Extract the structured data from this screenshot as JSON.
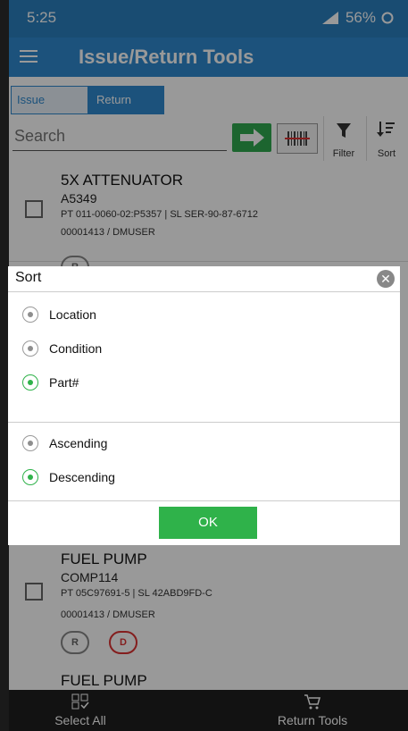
{
  "status": {
    "time": "5:25",
    "battery": "56%"
  },
  "app": {
    "title": "Issue/Return Tools"
  },
  "tabs": [
    {
      "label": "Issue"
    },
    {
      "label": "Return"
    }
  ],
  "search": {
    "placeholder": "Search",
    "filter_label": "Filter",
    "sort_label": "Sort"
  },
  "items": [
    {
      "title": "5X ATTENUATOR",
      "code": "A5349",
      "pt": "PT 011-0060-02:P5357 | SL SER-90-87-6712",
      "user": "00001413 / DMUSER",
      "badges": [
        "R"
      ]
    },
    {
      "title": "FUEL PUMP",
      "code": "COMP114",
      "pt": "PT 05C97691-5 | SL 42ABD9FD-C",
      "user": "00001413 / DMUSER",
      "badges": [
        "R",
        "D"
      ]
    },
    {
      "title": "FUEL PUMP"
    }
  ],
  "bottom": {
    "select_all": "Select All",
    "return_tools": "Return Tools"
  },
  "dialog": {
    "title": "Sort",
    "close_icon": "close-icon",
    "sort_fields": [
      {
        "label": "Location",
        "selected": false
      },
      {
        "label": "Condition",
        "selected": false
      },
      {
        "label": "Part#",
        "selected": true
      }
    ],
    "sort_orders": [
      {
        "label": "Ascending",
        "selected": false
      },
      {
        "label": "Descending",
        "selected": true
      }
    ],
    "ok_label": "OK"
  },
  "colors": {
    "appbar": "#2f89cf",
    "accent_green": "#2fb24a",
    "badge_d": "#d33333"
  }
}
